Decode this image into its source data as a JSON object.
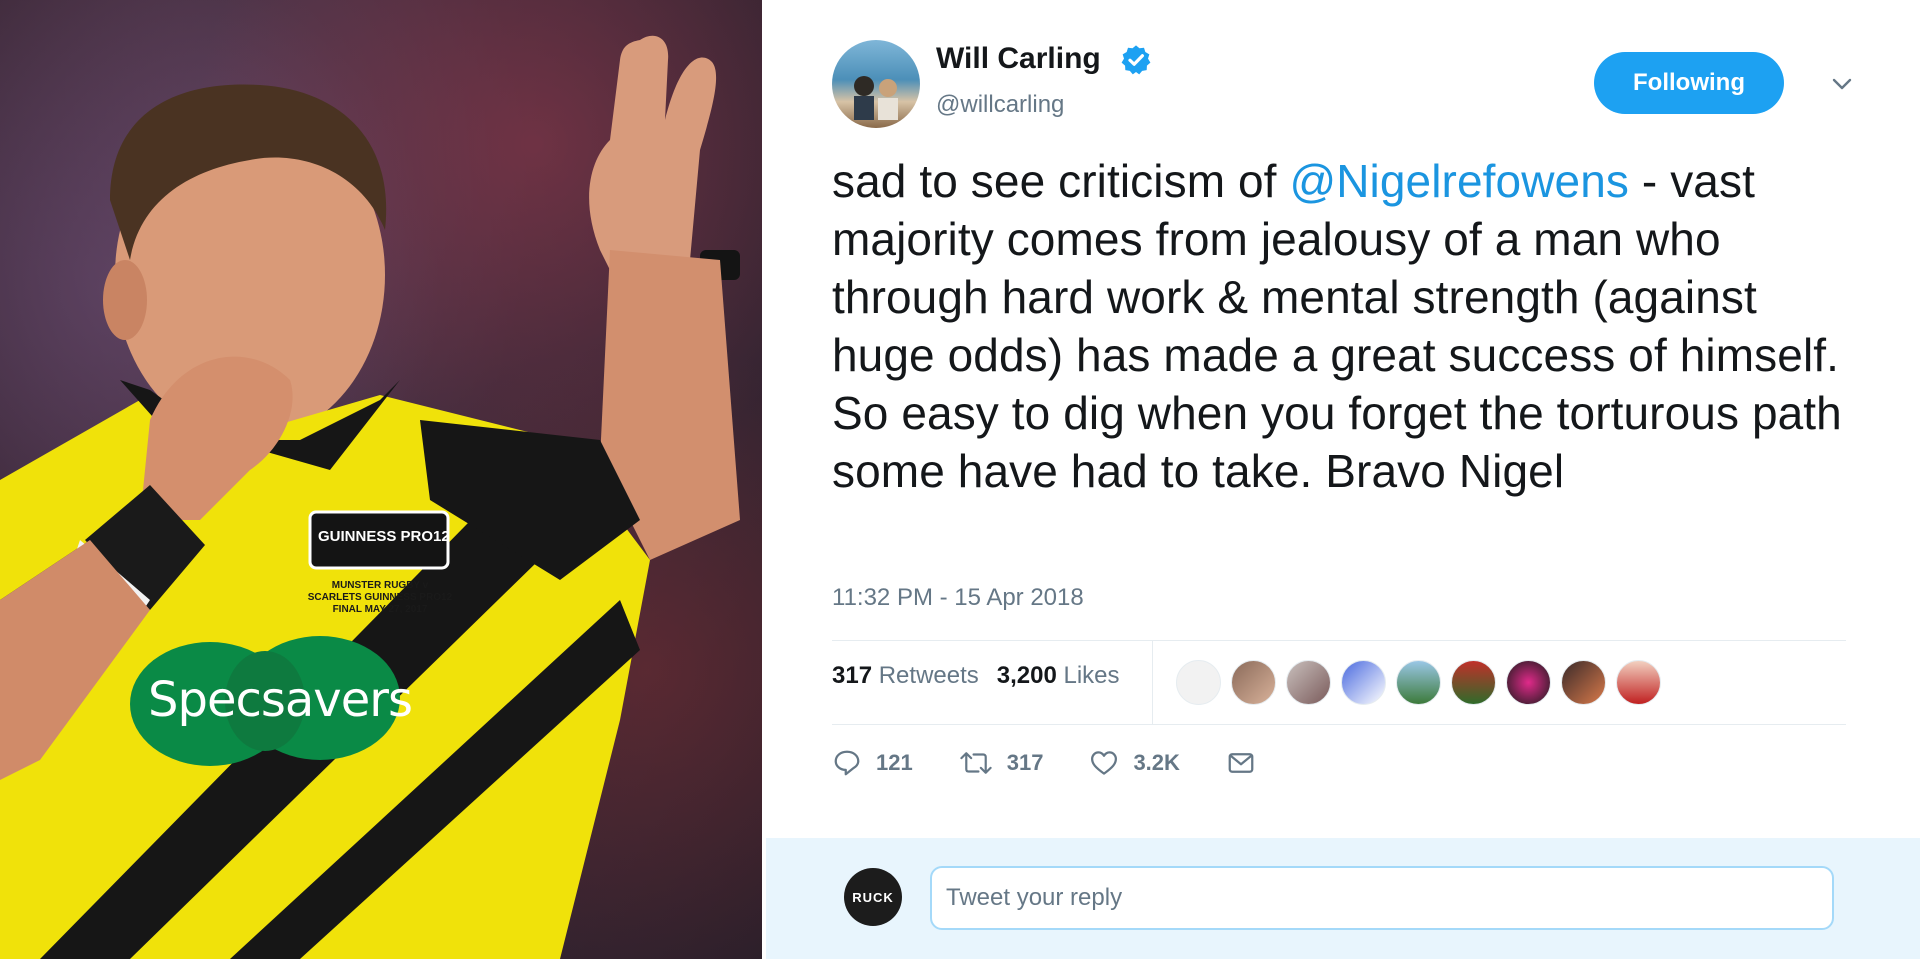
{
  "tweet": {
    "display_name": "Will Carling",
    "handle": "@willcarling",
    "follow_label": "Following",
    "text_before": "sad to see criticism of ",
    "mention": "@Nigelrefowens",
    "text_after": " - vast majority comes from jealousy of a man who through hard work & mental strength (against huge odds) has made a great success of himself. So easy to dig when you forget the torturous path some have had to take. Bravo Nigel",
    "timestamp": "11:32 PM - 15 Apr 2018",
    "stats": {
      "retweets_count": "317",
      "retweets_label": "Retweets",
      "likes_count": "3,200",
      "likes_label": "Likes"
    },
    "actions": {
      "reply_count": "121",
      "retweet_count": "317",
      "like_count": "3.2K"
    },
    "reply": {
      "avatar_text": "RUCK",
      "placeholder": "Tweet your reply"
    }
  },
  "photo_text": {
    "sponsor": "Specsavers",
    "brand": "GUINNESS PRO12",
    "event": "MUNSTER RUGBY v SCARLETS GUINNESS PRO12 FINAL MAY 27, 2017"
  },
  "colors": {
    "accent": "#1da1f2",
    "mention": "#1b95e0",
    "muted": "#657786",
    "shirt_yellow": "#f0e20a",
    "specsavers_green": "#0a8a46"
  },
  "icons": [
    "verified-badge-icon",
    "chevron-down-icon",
    "reply-icon",
    "retweet-icon",
    "like-icon",
    "message-icon"
  ]
}
